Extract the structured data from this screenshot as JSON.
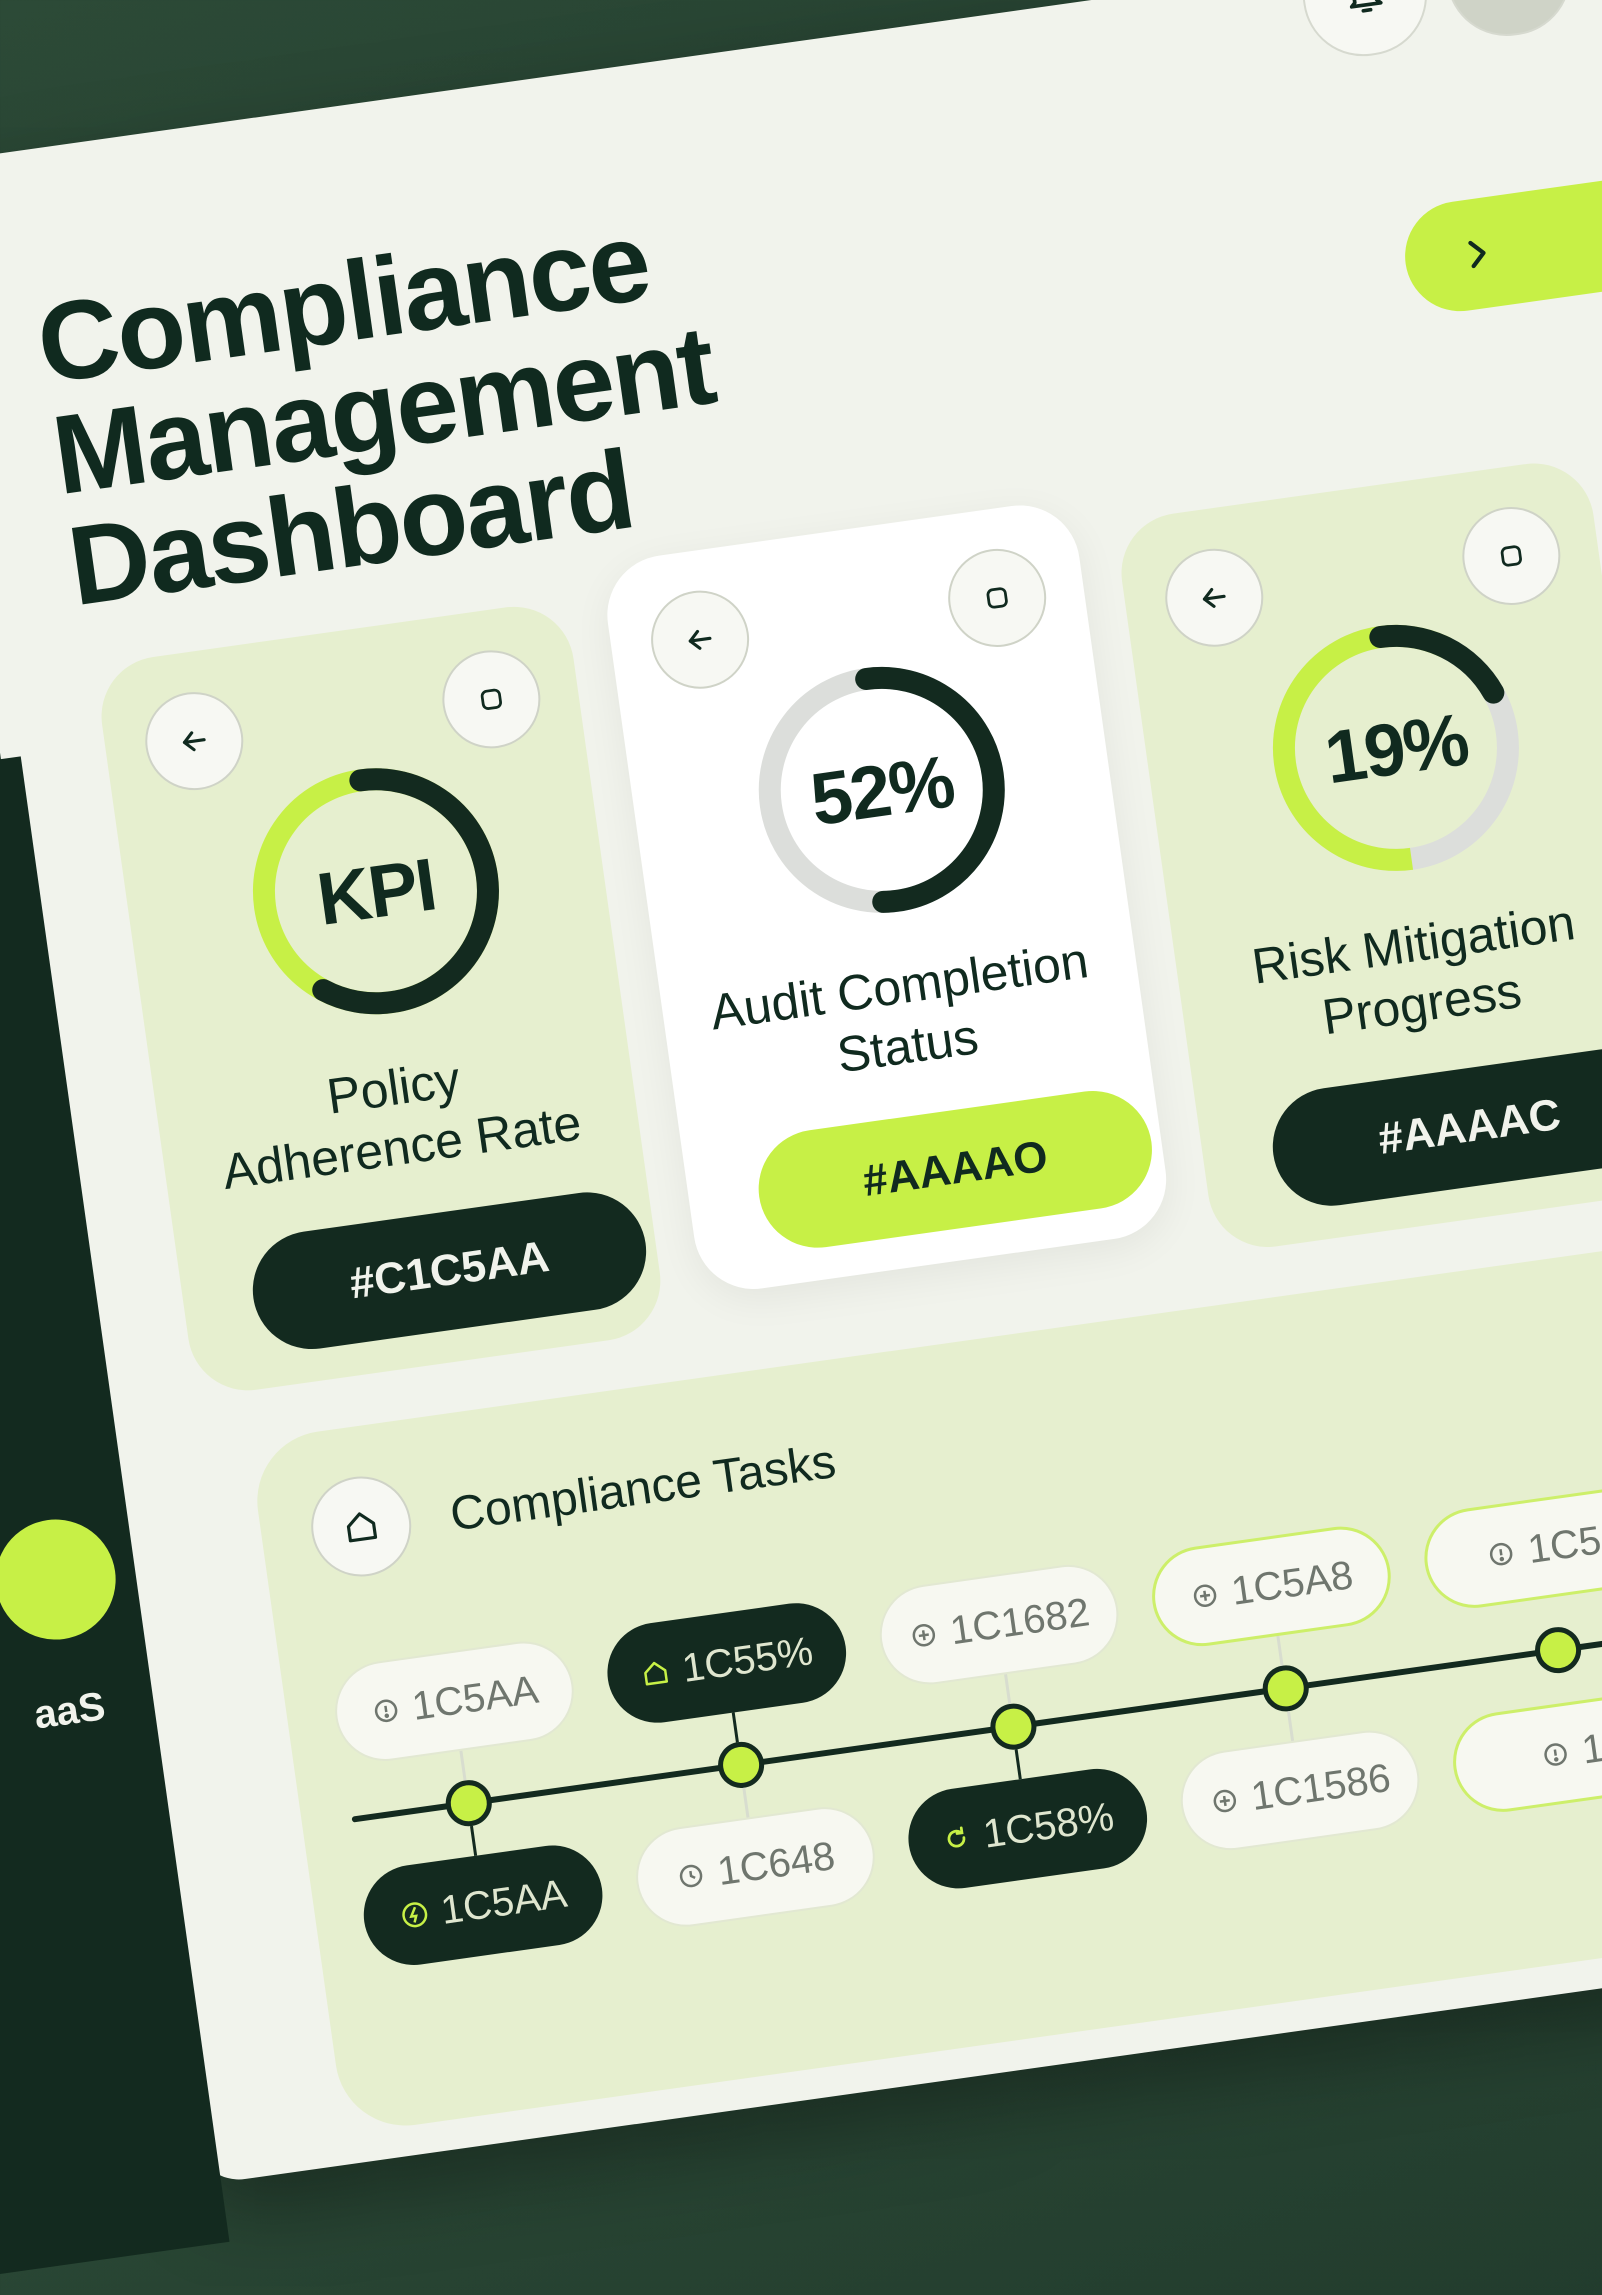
{
  "title": "Compliance\nManagement\nDashboard",
  "sidebar": {
    "label": "aaS"
  },
  "header": {
    "notifications_icon": "bell-icon",
    "next_icon": "chevron-right-icon"
  },
  "cards": [
    {
      "ring_text": "KPI",
      "label": "Policy\nAdherence Rate",
      "tag": "#C1C5AA",
      "progress_pct": 60
    },
    {
      "ring_text": "52%",
      "label": "Audit Completion\nStatus",
      "tag": "#AAAAO",
      "progress_pct": 52
    },
    {
      "ring_text": "19%",
      "label": "Risk Mitigation\nProgress",
      "tag": "#AAAAC",
      "progress_pct": 19
    }
  ],
  "tasks": {
    "title": "Compliance Tasks",
    "icon": "home-icon",
    "chips": [
      {
        "label": "1C5AA",
        "icon": "alert-icon"
      },
      {
        "label": "1C5AA",
        "icon": "bolt-icon"
      },
      {
        "label": "1C55%",
        "icon": "home-icon"
      },
      {
        "label": "1C648",
        "icon": "clock-icon"
      },
      {
        "label": "1C1682",
        "icon": "plus-icon"
      },
      {
        "label": "1C58%",
        "icon": "refresh-icon"
      },
      {
        "label": "1C5A8",
        "icon": "plus-icon"
      },
      {
        "label": "1C1586",
        "icon": "plus-icon"
      },
      {
        "label": "1C5",
        "icon": "alert-icon"
      },
      {
        "label": "1",
        "icon": "alert-icon"
      }
    ]
  },
  "colors": {
    "accent": "#c7f046",
    "dark": "#132a1f",
    "panel": "#f1f3ec",
    "card": "#e6efcf"
  }
}
